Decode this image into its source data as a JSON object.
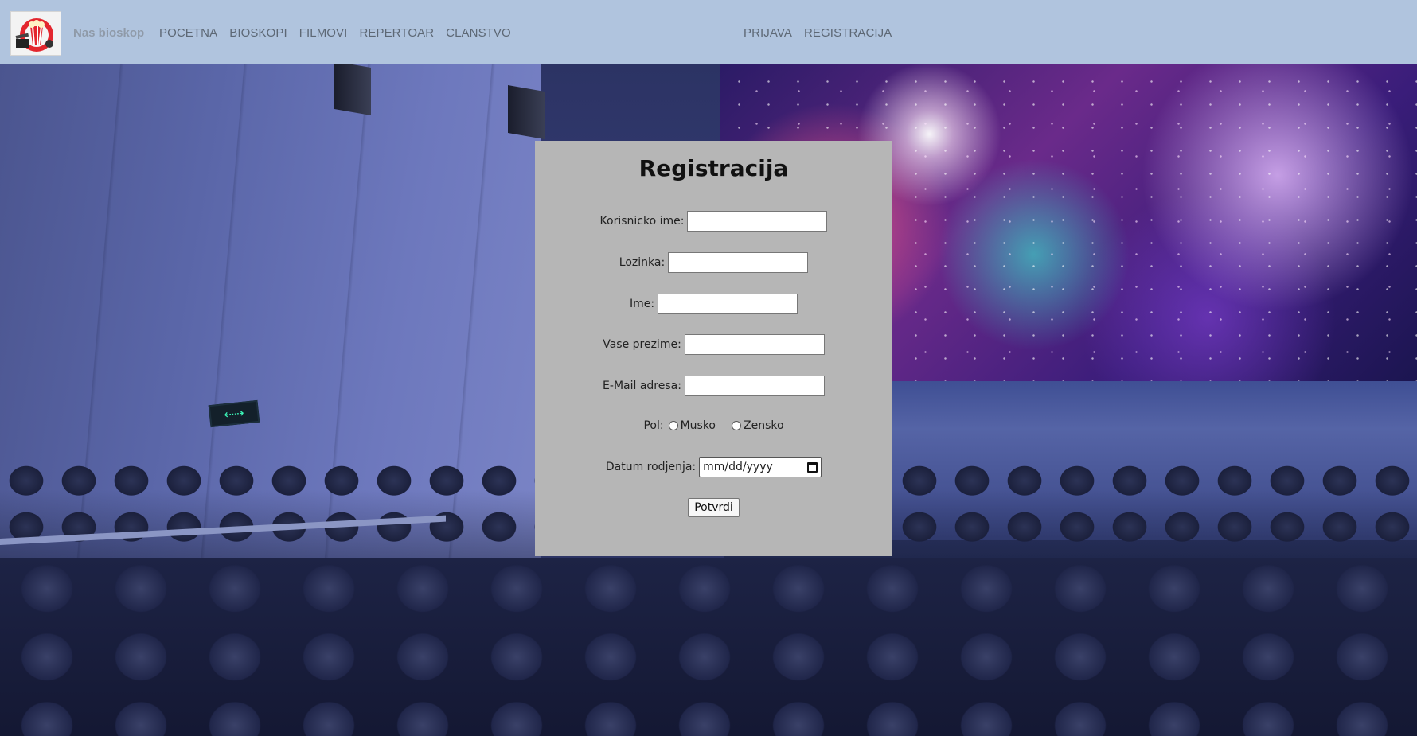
{
  "navbar": {
    "brand": "Nas bioskop",
    "left_links": [
      "POCETNA",
      "BIOSKOPI",
      "FILMOVI",
      "REPERTOAR",
      "CLANSTVO"
    ],
    "right_links": [
      "PRIJAVA",
      "REGISTRACIJA"
    ],
    "background_color": "#b0c4de"
  },
  "form": {
    "title": "Registracija",
    "fields": {
      "username_label": "Korisnicko ime:",
      "password_label": "Lozinka:",
      "first_name_label": "Ime:",
      "last_name_label": "Vase prezime:",
      "email_label": "E-Mail adresa:",
      "gender_label": "Pol:",
      "gender_options": [
        "Musko",
        "Zensko"
      ],
      "birthdate_label": "Datum rodjenja:",
      "birthdate_placeholder": "mm/dd/yyyy"
    },
    "submit_label": "Potvrdi",
    "panel_color": "#b6b6b6"
  },
  "icons": {
    "logo": "popcorn-clapperboard-logo-icon",
    "calendar": "calendar-icon",
    "exit_sign": "exit-sign-icon"
  }
}
